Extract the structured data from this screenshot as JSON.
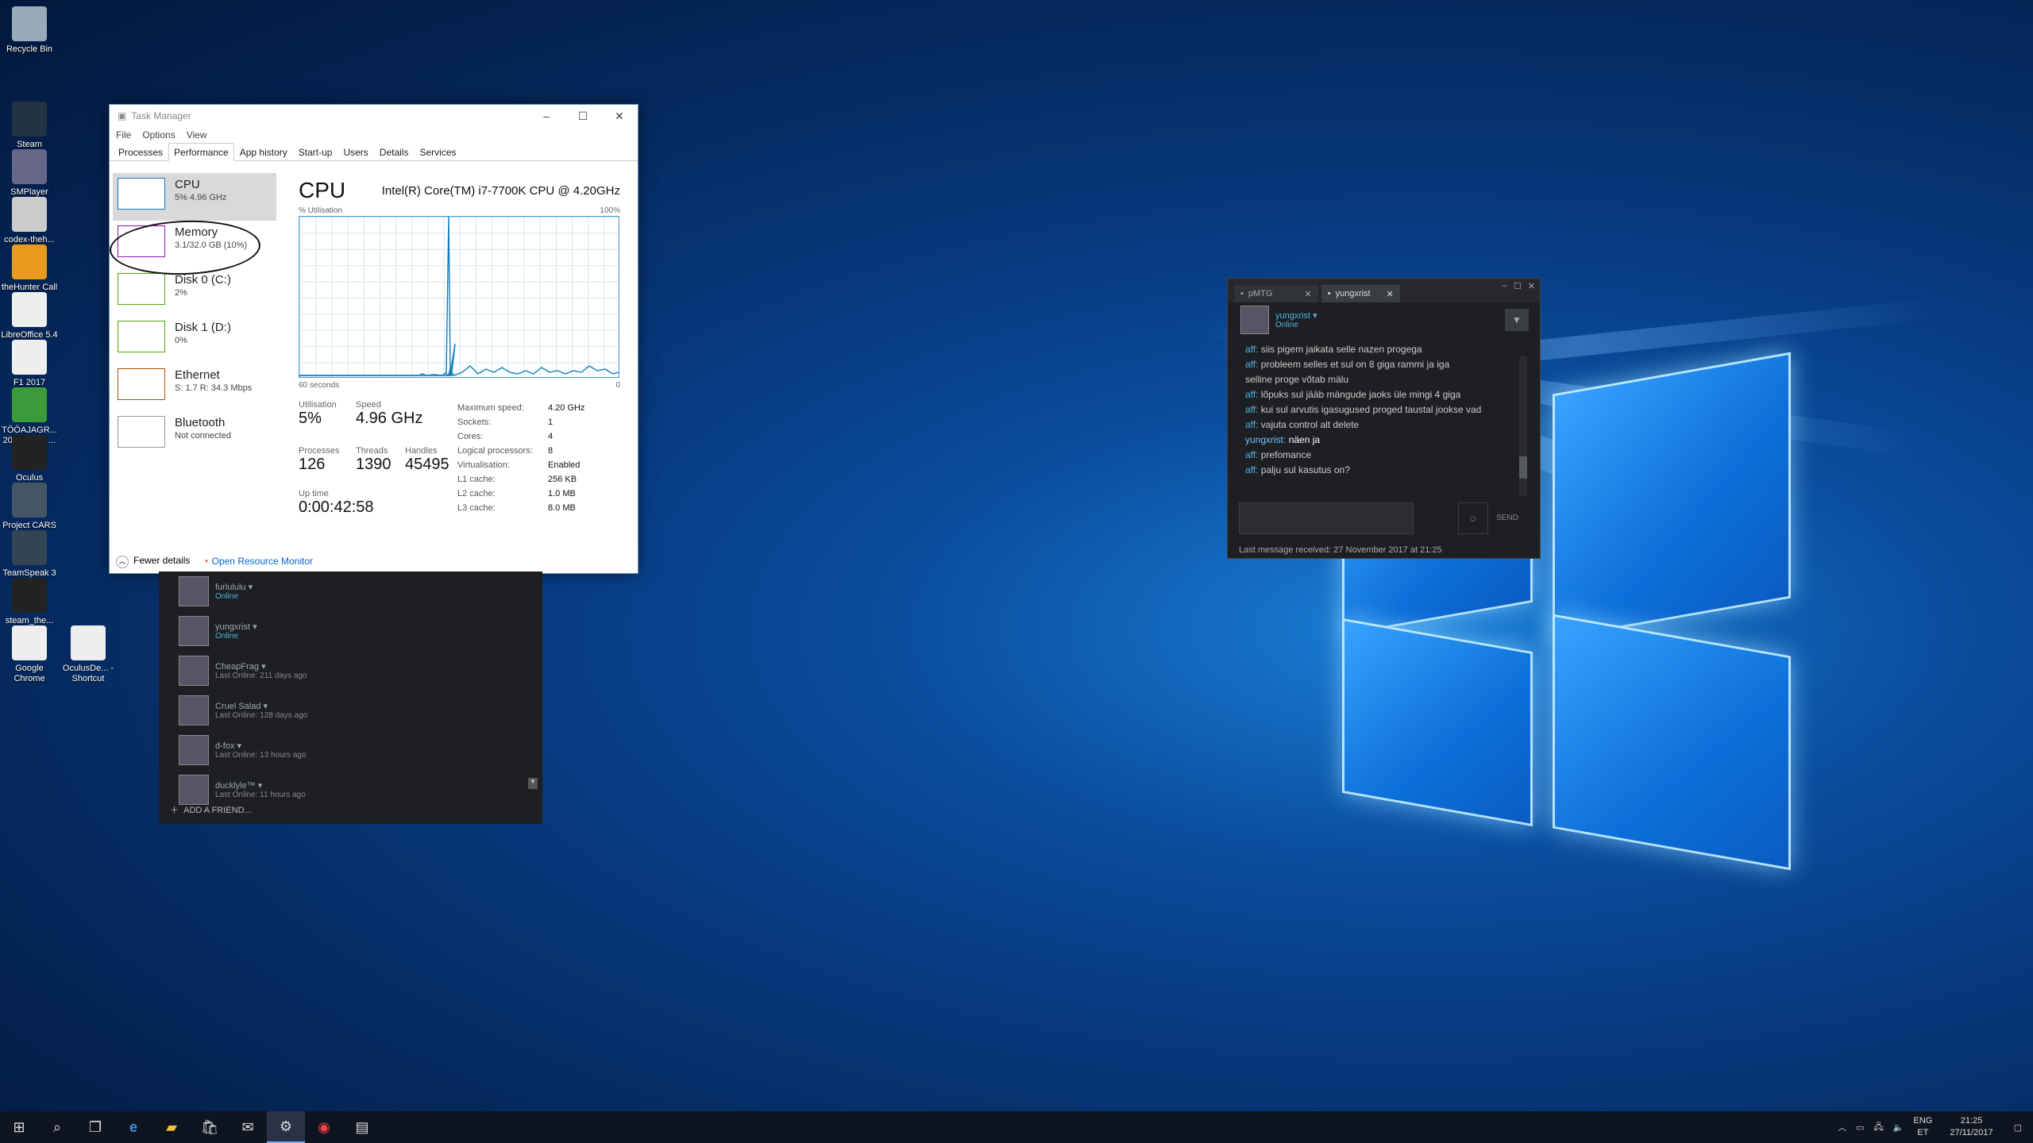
{
  "desktop_icons": [
    {
      "label": "Recycle Bin",
      "icon": "recycle-bin-icon"
    },
    {
      "label": "Steam",
      "icon": "steam-icon"
    },
    {
      "label": "SMPlayer",
      "icon": "smplayer-icon"
    },
    {
      "label": "codex-theh...",
      "icon": "disc-icon"
    },
    {
      "label": "theHunter Call of t...",
      "icon": "hunter-icon"
    },
    {
      "label": "LibreOffice 5.4",
      "icon": "file-icon"
    },
    {
      "label": "F1 2017",
      "icon": "file-icon"
    },
    {
      "label": "TÖÖAJAGR... 2017 aasta ...",
      "icon": "spreadsheet-icon"
    },
    {
      "label": "Oculus",
      "icon": "oculus-icon"
    },
    {
      "label": "Project CARS 2",
      "icon": "pcars-icon"
    },
    {
      "label": "TeamSpeak 3 Client",
      "icon": "teamspeak-icon"
    },
    {
      "label": "steam_the...",
      "icon": "smiley-icon"
    },
    {
      "label": "Google Chrome",
      "icon": "chrome-icon"
    },
    {
      "label": "OculusDe... - Shortcut",
      "icon": "oculus-icon"
    }
  ],
  "task_manager": {
    "title": "Task Manager",
    "menu": [
      "File",
      "Options",
      "View"
    ],
    "tabs": [
      "Processes",
      "Performance",
      "App history",
      "Start-up",
      "Users",
      "Details",
      "Services"
    ],
    "active_tab": "Performance",
    "sidebar": [
      {
        "name": "CPU",
        "sub": "5% 4.96 GHz",
        "color": "#117dbb"
      },
      {
        "name": "Memory",
        "sub": "3.1/32.0 GB (10%)",
        "color": "#8b12ae"
      },
      {
        "name": "Disk 0 (C:)",
        "sub": "2%",
        "color": "#4da60c"
      },
      {
        "name": "Disk 1 (D:)",
        "sub": "0%",
        "color": "#4da60c"
      },
      {
        "name": "Ethernet",
        "sub": "S: 1.7 R: 34.3 Mbps",
        "color": "#a74f01"
      },
      {
        "name": "Bluetooth",
        "sub": "Not connected",
        "color": "#999999"
      }
    ],
    "main": {
      "title": "CPU",
      "cpu_name": "Intel(R) Core(TM) i7-7700K CPU @ 4.20GHz",
      "util_label": "% Utilisation",
      "util_max": "100%",
      "time_label": "60 seconds",
      "time_min": "0",
      "utilisation": {
        "label": "Utilisation",
        "value": "5%"
      },
      "speed": {
        "label": "Speed",
        "value": "4.96 GHz"
      },
      "processes": {
        "label": "Processes",
        "value": "126"
      },
      "threads": {
        "label": "Threads",
        "value": "1390"
      },
      "handles": {
        "label": "Handles",
        "value": "45495"
      },
      "uptime": {
        "label": "Up time",
        "value": "0:00:42:58"
      },
      "specs": [
        {
          "k": "Maximum speed:",
          "v": "4.20 GHz"
        },
        {
          "k": "Sockets:",
          "v": "1"
        },
        {
          "k": "Cores:",
          "v": "4"
        },
        {
          "k": "Logical processors:",
          "v": "8"
        },
        {
          "k": "Virtualisation:",
          "v": "Enabled"
        },
        {
          "k": "L1 cache:",
          "v": "256 KB"
        },
        {
          "k": "L2 cache:",
          "v": "1.0 MB"
        },
        {
          "k": "L3 cache:",
          "v": "8.0 MB"
        }
      ]
    },
    "footer": {
      "fewer": "Fewer details",
      "resmon": "Open Resource Monitor"
    }
  },
  "friends": [
    {
      "name": "furlululu",
      "status": "Online",
      "online": true
    },
    {
      "name": "yungxrist",
      "status": "Online",
      "online": true
    },
    {
      "name": "CheapFrag",
      "status": "Last Online: 211 days ago",
      "online": false
    },
    {
      "name": "Cruel Salad",
      "status": "Last Online: 128 days ago",
      "online": false
    },
    {
      "name": "d-fox",
      "status": "Last Online: 13 hours ago",
      "online": false
    },
    {
      "name": "ducklyle™",
      "status": "Last Online: 11 hours ago",
      "online": false
    }
  ],
  "add_friend": "ADD A FRIEND...",
  "chat": {
    "tabs": [
      {
        "label": "pMTG"
      },
      {
        "label": "yungxrist"
      }
    ],
    "user": "yungxrist",
    "user_status": "Online",
    "messages": [
      {
        "who": "aff",
        "text": "siis pigem jaikata selle nazen progega"
      },
      {
        "who": "aff",
        "text": "probleem selles et sul on 8 giga rammi ja iga"
      },
      {
        "who": "",
        "text": "selline proge võtab mälu"
      },
      {
        "who": "aff",
        "text": "lõpuks sul jääb mängude jaoks üle mingi 4 giga"
      },
      {
        "who": "aff",
        "text": "kui sul arvutis igasugused proged taustal jookse vad"
      },
      {
        "who": "aff",
        "text": "vajuta control alt delete"
      },
      {
        "who": "yungxrist",
        "text": "näen ja"
      },
      {
        "who": "aff",
        "text": "prefomance"
      },
      {
        "who": "aff",
        "text": "palju sul kasutus on?"
      }
    ],
    "send": "SEND",
    "last": "Last message received: 27 November 2017 at 21:25"
  },
  "taskbar": {
    "lang": "ENG",
    "lang2": "ET",
    "time": "21:25",
    "date": "27/11/2017"
  }
}
